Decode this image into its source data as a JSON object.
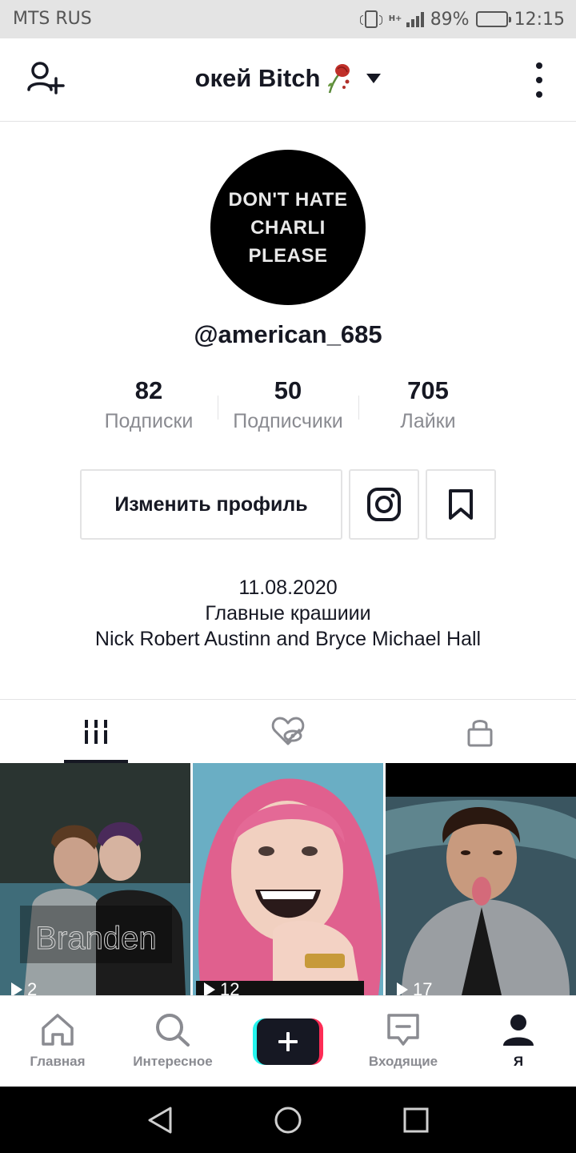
{
  "status_bar": {
    "carrier": "MTS RUS",
    "network": "H+",
    "battery": "89%",
    "battery_level": 0.89,
    "time": "12:15"
  },
  "header": {
    "title": "окей Bitch",
    "add_user_icon": "add-user-icon",
    "rose_icon": "wilted-rose-emoji",
    "dropdown_icon": "caret-down-icon",
    "menu_icon": "more-vertical-icon"
  },
  "profile": {
    "avatar_text": [
      "DON'T HATE",
      "CHARLI",
      "PLEASE"
    ],
    "username": "@american_685"
  },
  "stats": [
    {
      "value": "82",
      "label": "Подписки"
    },
    {
      "value": "50",
      "label": "Подписчики"
    },
    {
      "value": "705",
      "label": "Лайки"
    }
  ],
  "actions": {
    "edit_profile": "Изменить профиль",
    "instagram_icon": "instagram-icon",
    "bookmark_icon": "bookmark-icon"
  },
  "bio": {
    "line1": "11.08.2020",
    "line2": "Главные крашиии",
    "line3": "Nick Robert Austinn and Bryce Michael Hall"
  },
  "tabs": [
    {
      "icon": "videos-grid-icon",
      "active": true
    },
    {
      "icon": "liked-hidden-icon",
      "active": false
    },
    {
      "icon": "lock-icon",
      "active": false
    }
  ],
  "videos": [
    {
      "views": "2",
      "overlay_text": "Branden"
    },
    {
      "views": "12",
      "overlay_text": ""
    },
    {
      "views": "17",
      "overlay_text": ""
    }
  ],
  "bottom_nav": {
    "home": "Главная",
    "discover": "Интересное",
    "inbox": "Входящие",
    "me": "Я",
    "create_icon": "plus-icon"
  },
  "colors": {
    "text": "#161823",
    "secondary_text": "#8a8b91",
    "border": "#e3e3e4",
    "cyan": "#25f4ee",
    "red": "#fe2c55"
  }
}
